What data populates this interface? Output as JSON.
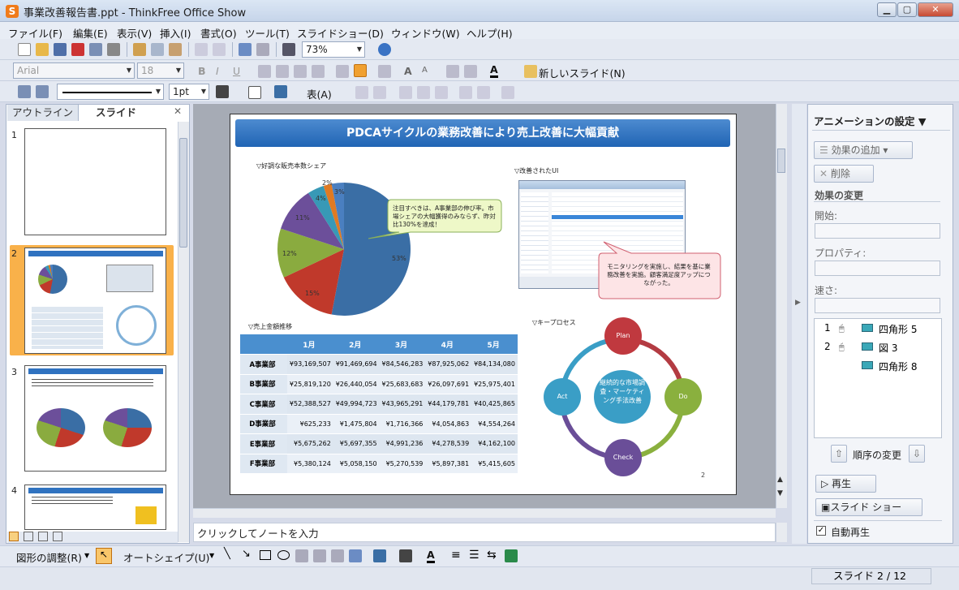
{
  "window": {
    "title": "事業改善報告書.ppt - ThinkFree Office Show",
    "app_icon": "S"
  },
  "menu": [
    "ファイル(F)",
    "編集(E)",
    "表示(V)",
    "挿入(I)",
    "書式(O)",
    "ツール(T)",
    "スライドショー(D)",
    "ウィンドウ(W)",
    "ヘルプ(H)"
  ],
  "toolbar": {
    "zoom": "73%",
    "font": "Arial",
    "size": "18",
    "new_slide": "新しいスライド(N)",
    "line_width": "1pt",
    "table_label": "表(A)"
  },
  "left_panel": {
    "tabs": [
      "アウトライン",
      "スライド"
    ],
    "slide_numbers": [
      "1",
      "2",
      "3",
      "4"
    ]
  },
  "slide": {
    "title": "PDCAサイクルの業務改善により売上改善に大幅貢献",
    "pie_title": "▽好調な販売本数シェア",
    "pie_labels": [
      "53%",
      "15%",
      "12%",
      "11%",
      "4%",
      "2%",
      "3%"
    ],
    "callout1": "注目すべきは、A事業部の伸び率。市場シェアの大幅獲得のみならず、昨対比130%を達成！",
    "ui_title": "▽改善されたUI",
    "callout2": "モニタリングを実施し、結果を基に業務改善を実施。顧客満足度アップにつながった。",
    "table_title": "▽売上金額推移",
    "table_headers": [
      "",
      "1月",
      "2月",
      "3月",
      "4月",
      "5月"
    ],
    "table_rows": [
      [
        "A事業部",
        "¥93,169,507",
        "¥91,469,694",
        "¥84,546,283",
        "¥87,925,062",
        "¥84,134,080"
      ],
      [
        "B事業部",
        "¥25,819,120",
        "¥26,440,054",
        "¥25,683,683",
        "¥26,097,691",
        "¥25,975,401"
      ],
      [
        "C事業部",
        "¥52,388,527",
        "¥49,994,723",
        "¥43,965,291",
        "¥44,179,781",
        "¥40,425,865"
      ],
      [
        "D事業部",
        "¥625,233",
        "¥1,475,804",
        "¥1,716,366",
        "¥4,054,863",
        "¥4,554,264"
      ],
      [
        "E事業部",
        "¥5,675,262",
        "¥5,697,355",
        "¥4,991,236",
        "¥4,278,539",
        "¥4,162,100"
      ],
      [
        "F事業部",
        "¥5,380,124",
        "¥5,058,150",
        "¥5,270,539",
        "¥5,897,381",
        "¥5,415,605"
      ]
    ],
    "process_title": "▽キープロセス",
    "cycle": {
      "plan": "Plan",
      "do": "Do",
      "check": "Check",
      "act": "Act",
      "center": "継続的な市場調査・マーケティング手法改善"
    },
    "page_number": "2"
  },
  "notes_placeholder": "クリックしてノートを入力",
  "right_panel": {
    "title": "アニメーションの設定 ▼",
    "add_effect": "効果の追加 ▾",
    "delete": "削除",
    "change_effect": "効果の変更",
    "start": "開始:",
    "property": "プロパティ:",
    "speed": "速さ:",
    "items": [
      {
        "num": "1",
        "name": "四角形 5"
      },
      {
        "num": "2",
        "name": "図 3"
      },
      {
        "num": "",
        "name": "四角形 8"
      }
    ],
    "reorder": "順序の変更",
    "play": "再生",
    "slideshow": "スライド ショー",
    "autoplay": "自動再生"
  },
  "drawing": {
    "adjust": "図形の調整(R)",
    "autoshape": "オートシェイプ(U)"
  },
  "status": {
    "slide": "スライド 2 / 12"
  },
  "colors": {
    "pie": [
      "#3a6ea5",
      "#c0392b",
      "#8aab3f",
      "#6c4f9a",
      "#3899b6",
      "#e07a22",
      "#4a7fc0"
    ],
    "accent": "#2064b4"
  }
}
